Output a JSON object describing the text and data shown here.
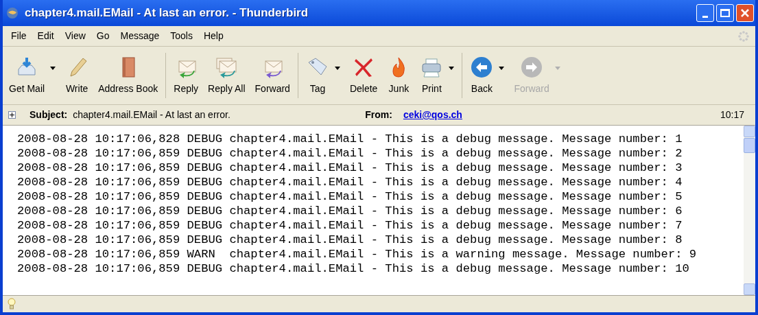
{
  "window": {
    "title": "chapter4.mail.EMail - At last an error. - Thunderbird"
  },
  "menu": [
    "File",
    "Edit",
    "View",
    "Go",
    "Message",
    "Tools",
    "Help"
  ],
  "toolbar": [
    {
      "kind": "getmail",
      "label": "Get Mail",
      "dropdown": true,
      "disabled": false
    },
    {
      "kind": "write",
      "label": "Write",
      "dropdown": false,
      "disabled": false
    },
    {
      "kind": "book",
      "label": "Address Book",
      "dropdown": false,
      "disabled": false
    },
    {
      "kind": "sep"
    },
    {
      "kind": "reply",
      "label": "Reply",
      "dropdown": false,
      "disabled": false
    },
    {
      "kind": "replyall",
      "label": "Reply All",
      "dropdown": false,
      "disabled": false
    },
    {
      "kind": "forward",
      "label": "Forward",
      "dropdown": false,
      "disabled": false
    },
    {
      "kind": "sep"
    },
    {
      "kind": "tag",
      "label": "Tag",
      "dropdown": true,
      "disabled": false
    },
    {
      "kind": "delete",
      "label": "Delete",
      "dropdown": false,
      "disabled": false
    },
    {
      "kind": "junk",
      "label": "Junk",
      "dropdown": false,
      "disabled": false
    },
    {
      "kind": "print",
      "label": "Print",
      "dropdown": true,
      "disabled": false
    },
    {
      "kind": "sep"
    },
    {
      "kind": "back",
      "label": "Back",
      "dropdown": true,
      "disabled": false
    },
    {
      "kind": "next",
      "label": "Forward",
      "dropdown": true,
      "disabled": true
    }
  ],
  "header": {
    "expanded": false,
    "subject_label": "Subject:",
    "subject": "chapter4.mail.EMail - At last an error.",
    "from_label": "From:",
    "from": "ceki@qos.ch",
    "time": "10:17"
  },
  "body": {
    "lines": [
      "2008-08-28 10:17:06,828 DEBUG chapter4.mail.EMail - This is a debug message. Message number: 1",
      "2008-08-28 10:17:06,859 DEBUG chapter4.mail.EMail - This is a debug message. Message number: 2",
      "2008-08-28 10:17:06,859 DEBUG chapter4.mail.EMail - This is a debug message. Message number: 3",
      "2008-08-28 10:17:06,859 DEBUG chapter4.mail.EMail - This is a debug message. Message number: 4",
      "2008-08-28 10:17:06,859 DEBUG chapter4.mail.EMail - This is a debug message. Message number: 5",
      "2008-08-28 10:17:06,859 DEBUG chapter4.mail.EMail - This is a debug message. Message number: 6",
      "2008-08-28 10:17:06,859 DEBUG chapter4.mail.EMail - This is a debug message. Message number: 7",
      "2008-08-28 10:17:06,859 DEBUG chapter4.mail.EMail - This is a debug message. Message number: 8",
      "2008-08-28 10:17:06,859 WARN  chapter4.mail.EMail - This is a warning message. Message number: 9",
      "2008-08-28 10:17:06,859 DEBUG chapter4.mail.EMail - This is a debug message. Message number: 10"
    ]
  }
}
